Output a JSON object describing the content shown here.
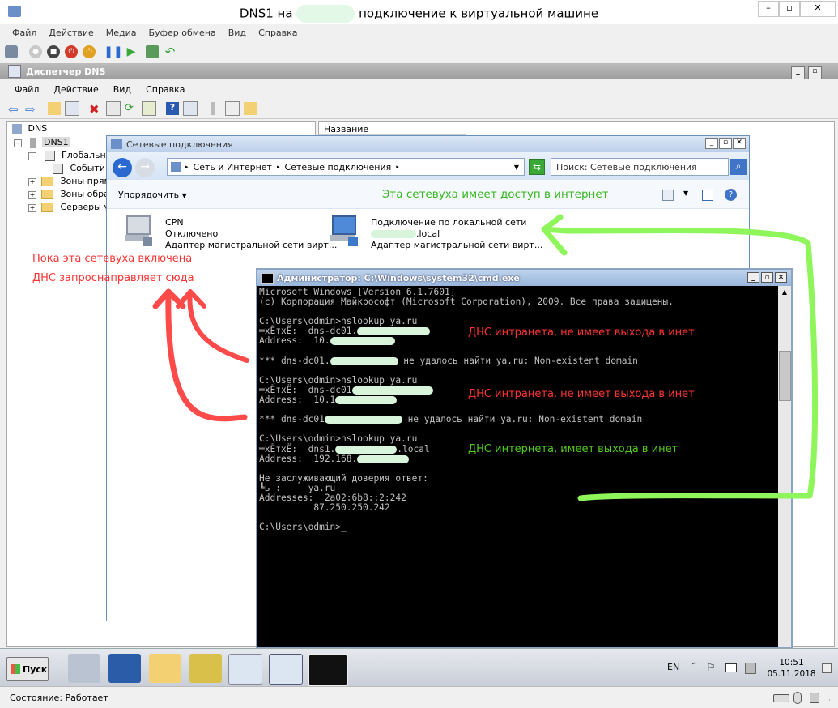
{
  "vm": {
    "title_prefix": "DNS1 на",
    "title_suffix": "подключение к виртуальной машине",
    "menu": [
      "Файл",
      "Действие",
      "Медиа",
      "Буфер обмена",
      "Вид",
      "Справка"
    ],
    "status": "Состояние: Работает"
  },
  "dns": {
    "title": "Диспетчер DNS",
    "menu": [
      "Файл",
      "Действие",
      "Вид",
      "Справка"
    ],
    "tree": {
      "root": "DNS",
      "server": "DNS1",
      "global": "Глобальны",
      "events": "Событи",
      "forward": "Зоны прямо",
      "reverse": "Зоны обрат",
      "servers": "Серверы ус"
    },
    "column_name": "Название"
  },
  "netwin": {
    "title": "Сетевые подключения",
    "breadcrumb1": "Сеть и Интернет",
    "breadcrumb2": "Сетевые подключения",
    "search_placeholder": "Поиск: Сетевые подключения",
    "organize": "Упорядочить",
    "conn1": {
      "name": "CPN",
      "status": "Отключено",
      "adapter": "Адаптер магистральной сети вирт..."
    },
    "conn2": {
      "name": "Подключение по локальной сети",
      "status": ".local",
      "adapter": "Адаптер магистральной сети вирт..."
    }
  },
  "cmd": {
    "title": "Администратор: C:\\Windows\\system32\\cmd.exe",
    "lines": {
      "l1": "Microsoft Windows [Version 6.1.7601]",
      "l2": "(c) Корпорация Майкрософт (Microsoft Corporation), 2009. Все права защищены.",
      "l3": "C:\\Users\\odmin>nslookup ya.ru",
      "l4": "╤хЁтхЁ:  dns-dc01.",
      "l5": "Address:  10.",
      "l6a": "*** dns-dc01.",
      "l6b": " не удалось найти ya.ru: Non-existent domain",
      "l7": "C:\\Users\\odmin>nslookup ya.ru",
      "l8": "╤хЁтхЁ:  dns-dc01",
      "l9": "Address:  10.1",
      "l10a": "*** dns-dc01",
      "l10b": " не удалось найти ya.ru: Non-existent domain",
      "l11": "C:\\Users\\odmin>nslookup ya.ru",
      "l12a": "╤хЁтхЁ:  dns1.",
      "l12b": ".local",
      "l13": "Address:  192.168.",
      "l14": "Не заслуживающий доверия ответ:",
      "l15": "╚ь :     ya.ru",
      "l16": "Addresses:  2a02:6b8::2:242",
      "l17": "          87.250.250.242",
      "l18": "C:\\Users\\odmin>"
    }
  },
  "annotations": {
    "internet": "Эта сетевуха имеет доступ в интернет",
    "red1": "Пока эта сетевуха включена",
    "red2": "ДНС запроснаправляет сюда",
    "intranet1": "ДНС интранета, не имеет выхода в инет",
    "intranet2": "ДНС интранета, не имеет выхода в инет",
    "internet_dns": "ДНС интернета, имеет выхода в инет"
  },
  "taskbar": {
    "start": "Пуск",
    "lang": "EN",
    "time": "10:51",
    "date": "05.11.2018"
  },
  "colors": {
    "annotation_red": "#ff3333",
    "annotation_green": "#52cc1a"
  }
}
